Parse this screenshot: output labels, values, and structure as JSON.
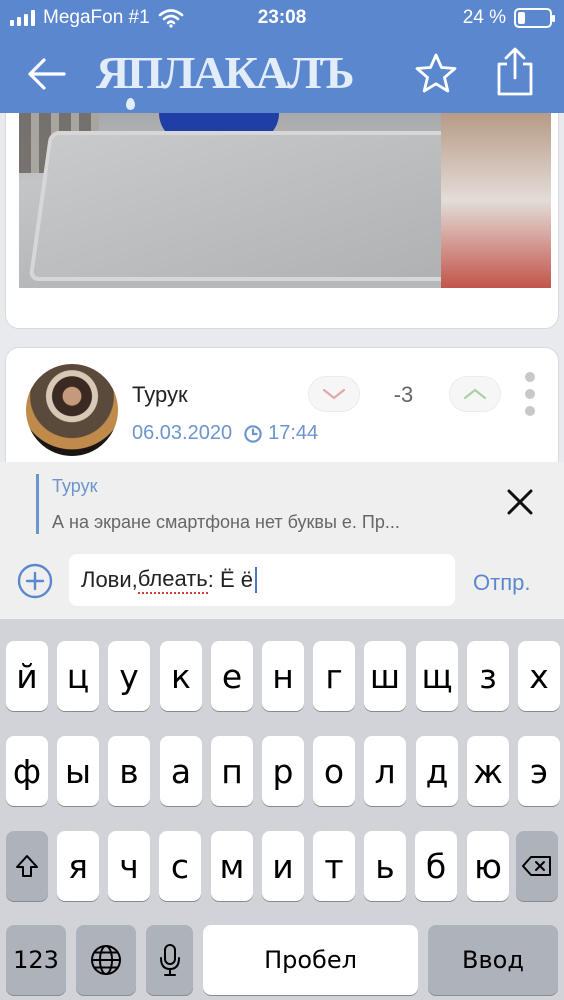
{
  "status_bar": {
    "carrier": "MegaFon #1",
    "time": "23:08",
    "battery": "24 %",
    "battery_level": 0.24
  },
  "nav": {
    "logo": "ЯПЛАКАЛЪ"
  },
  "comment": {
    "author": "Турук",
    "date": "06.03.2020",
    "time": "17:44",
    "score": "-3"
  },
  "reply": {
    "quote_author": "Турук",
    "quote_text": "А на экране смартфона нет буквы е. Пр...",
    "input_before": "Лови, ",
    "input_misspelled": "блеать",
    "input_after": ": Ё ё",
    "send_label": "Отпр."
  },
  "keyboard": {
    "row1": [
      "й",
      "ц",
      "у",
      "к",
      "е",
      "н",
      "г",
      "ш",
      "щ",
      "з",
      "х"
    ],
    "row2": [
      "ф",
      "ы",
      "в",
      "а",
      "п",
      "р",
      "о",
      "л",
      "д",
      "ж",
      "э"
    ],
    "row3": [
      "я",
      "ч",
      "с",
      "м",
      "и",
      "т",
      "ь",
      "б",
      "ю"
    ],
    "numbers_label": "123",
    "space_label": "Пробел",
    "return_label": "Ввод"
  },
  "colors": {
    "header": "#5b87cf",
    "accent": "#6b95cc"
  }
}
